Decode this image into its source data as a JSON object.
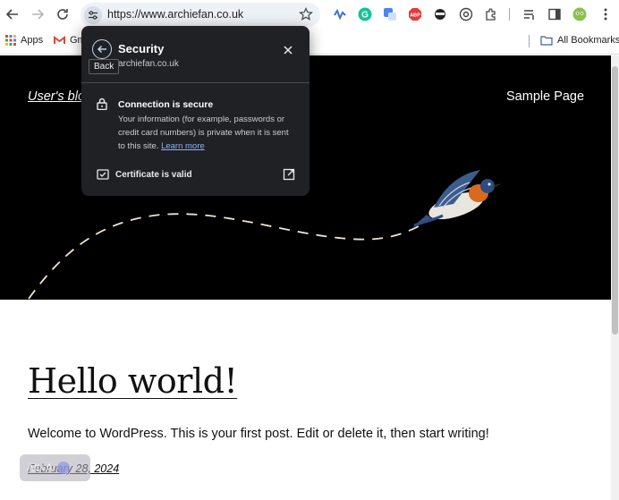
{
  "browser": {
    "url": "https://www.archiefan.co.uk",
    "bookmarks": [
      {
        "label": "Apps"
      },
      {
        "label": "Gm"
      }
    ],
    "all_bookmarks_label": "All Bookmarks"
  },
  "security_popup": {
    "title": "Security",
    "host": "archiefan.co.uk",
    "back_tooltip": "Back",
    "connection_title": "Connection is secure",
    "connection_desc": "Your information (for example, passwords or credit card numbers) is private when it is sent to this site.",
    "learn_more": "Learn more",
    "certificate_label": "Certificate is valid"
  },
  "page": {
    "site_title": "User's blog",
    "nav_sample": "Sample Page",
    "post_title": "Hello world!",
    "post_body": "Welcome to WordPress. This is your first post. Edit or delete it, then start writing!",
    "post_date": "February 28, 2024",
    "pill_text": "Alt+A"
  },
  "colors": {
    "hero_bg": "#000000",
    "popup_bg": "#202124",
    "link_blue": "#8ab4f8"
  }
}
